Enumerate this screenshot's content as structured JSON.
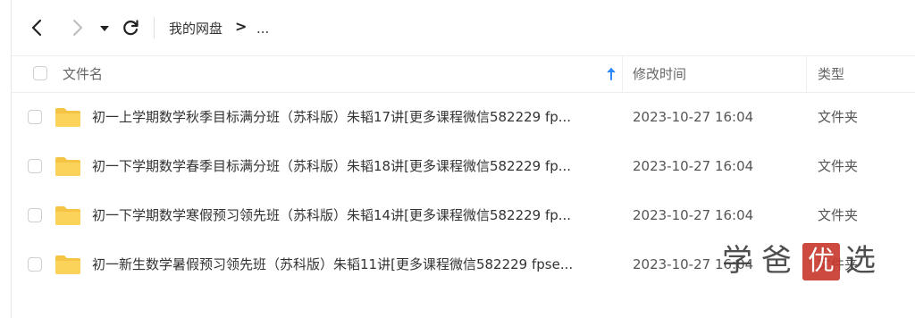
{
  "nav": {
    "back_icon": "chevron-left-icon",
    "forward_icon": "chevron-right-icon",
    "dropdown_icon": "caret-down-icon",
    "refresh_icon": "refresh-icon"
  },
  "breadcrumb": {
    "root": "我的网盘",
    "separator": ">",
    "more": "..."
  },
  "table": {
    "headers": {
      "name": "文件名",
      "modified": "修改时间",
      "type": "类型"
    },
    "sort_icon": "arrow-up-icon",
    "rows": [
      {
        "name": "初一上学期数学秋季目标满分班（苏科版）朱韬17讲[更多课程微信582229 fp...",
        "modified": "2023-10-27 16:04",
        "type": "文件夹",
        "icon": "folder-icon"
      },
      {
        "name": "初一下学期数学春季目标满分班（苏科版）朱韬18讲[更多课程微信582229 fp...",
        "modified": "2023-10-27 16:04",
        "type": "文件夹",
        "icon": "folder-icon"
      },
      {
        "name": "初一下学期数学寒假预习领先班（苏科版）朱韬14讲[更多课程微信582229 fp...",
        "modified": "2023-10-27 16:04",
        "type": "文件夹",
        "icon": "folder-icon"
      },
      {
        "name": "初一新生数学暑假预习领先班（苏科版）朱韬11讲[更多课程微信582229 fpse...",
        "modified": "2023-10-27 16:04",
        "type": "文件夹",
        "icon": "folder-icon"
      }
    ]
  },
  "watermark": {
    "c1": "学",
    "c2": "爸",
    "c3": "优",
    "c4": "选"
  },
  "colors": {
    "folder": "#f6c445",
    "sort_accent": "#2f88ff",
    "seal": "#c8372d"
  }
}
